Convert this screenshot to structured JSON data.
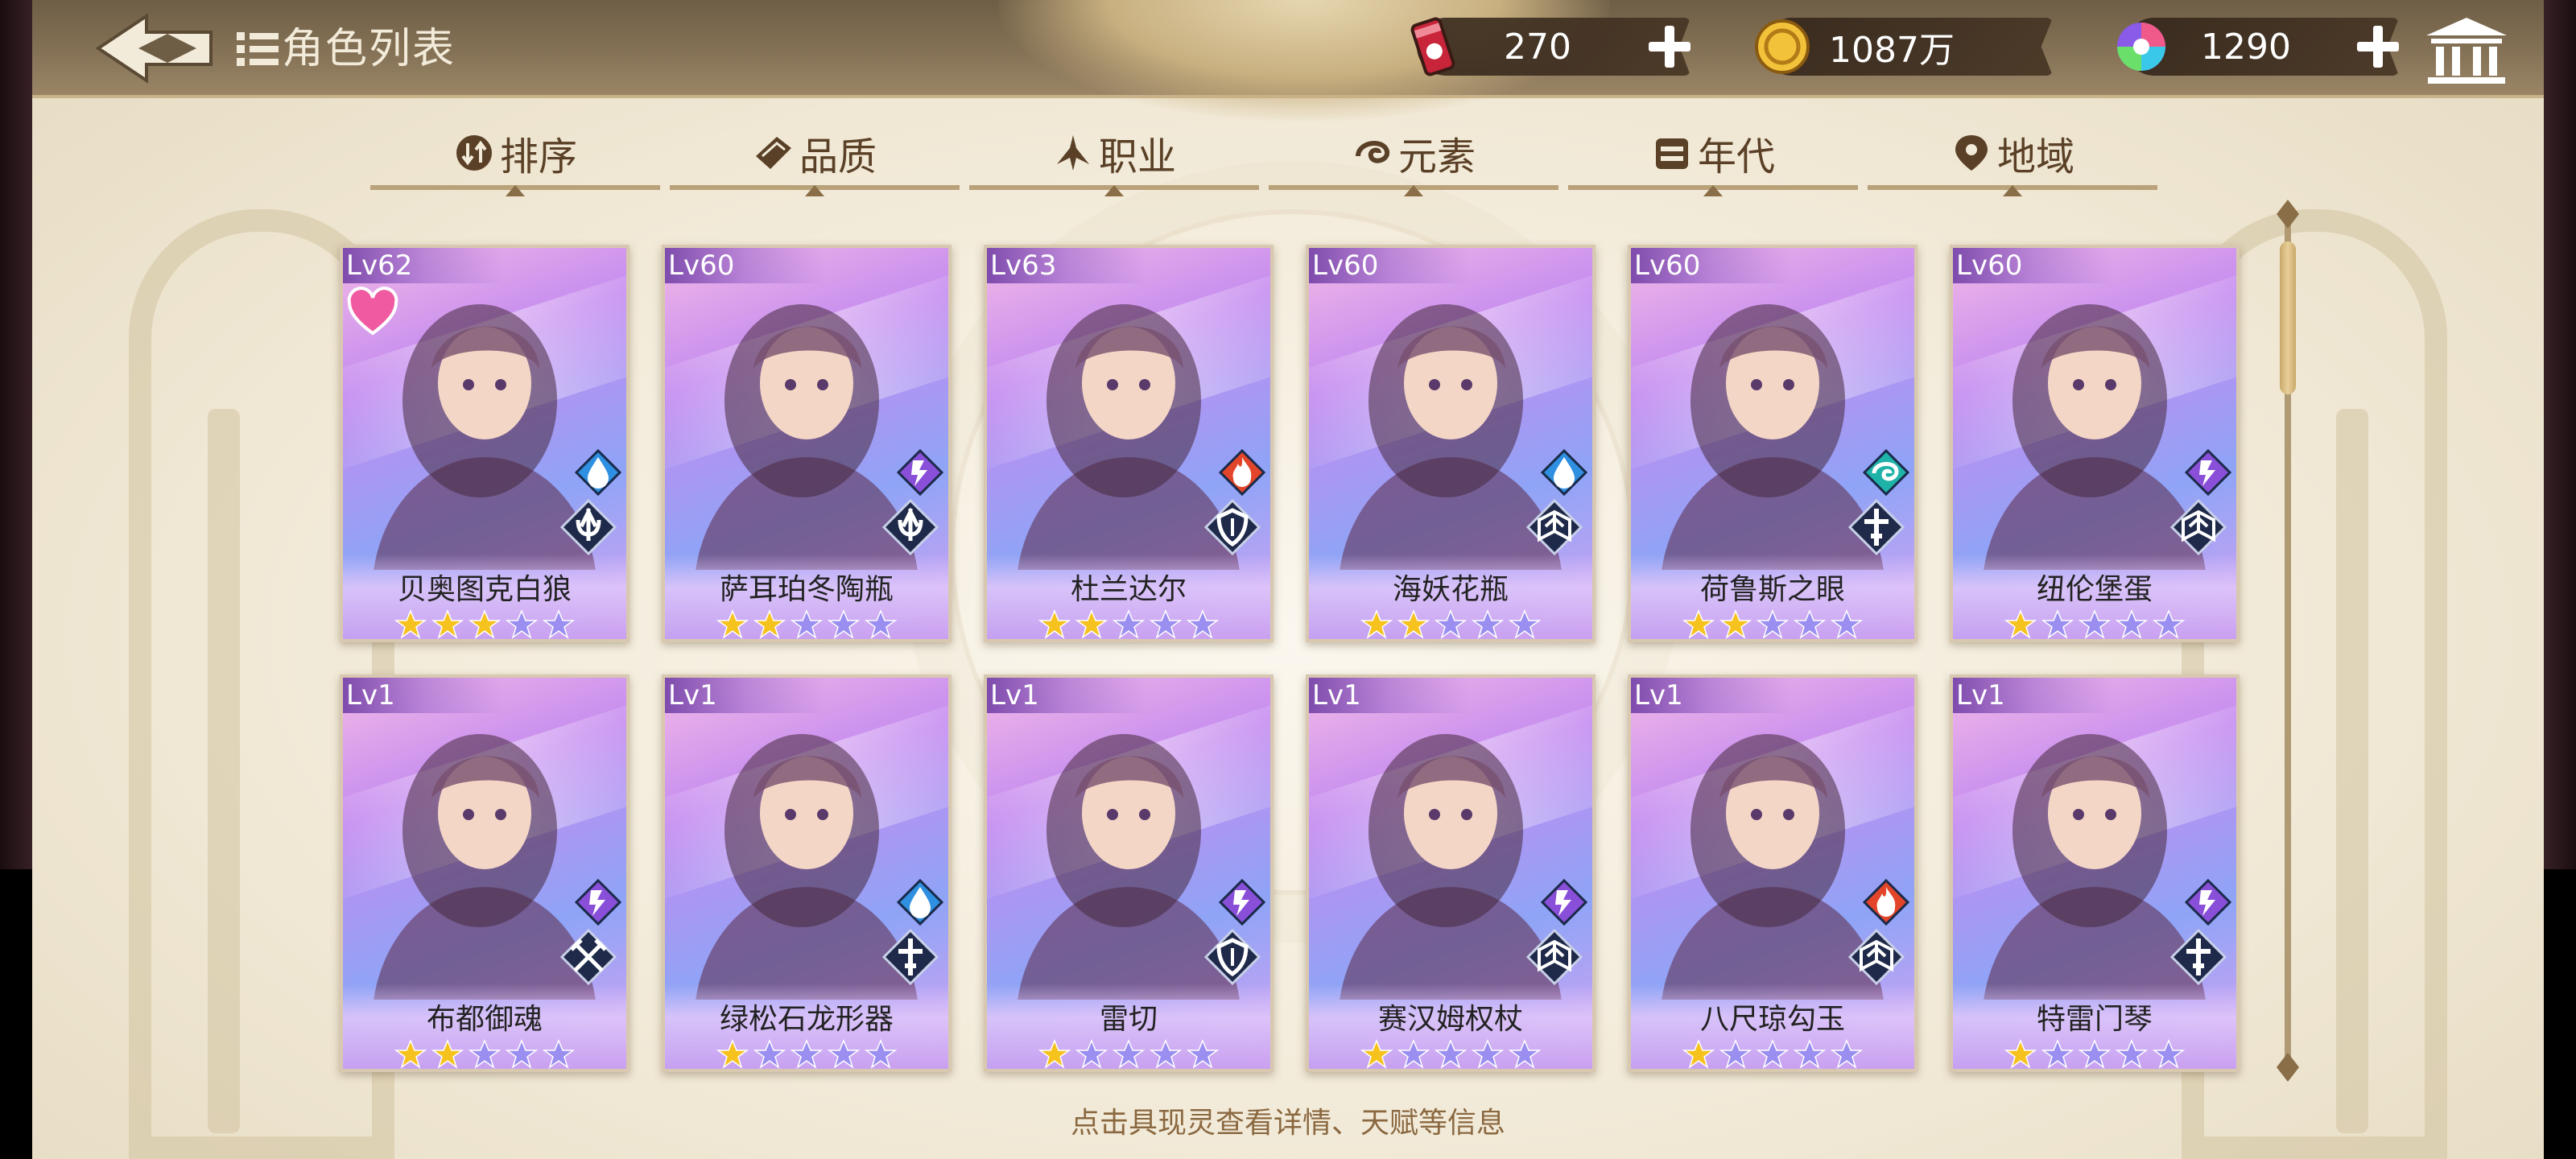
{
  "header": {
    "title": "角色列表",
    "back_icon": "back-arrow-icon",
    "museum_icon": "museum-icon"
  },
  "resources": [
    {
      "icon": "stamina-can-icon",
      "value": "270"
    },
    {
      "icon": "gold-coin-icon",
      "value": "1087万"
    },
    {
      "icon": "rainbow-gem-icon",
      "value": "1290"
    }
  ],
  "tabs": [
    {
      "icon": "sort-icon",
      "label": "排序"
    },
    {
      "icon": "quality-icon",
      "label": "品质"
    },
    {
      "icon": "class-icon",
      "label": "职业"
    },
    {
      "icon": "element-icon",
      "label": "元素"
    },
    {
      "icon": "era-icon",
      "label": "年代"
    },
    {
      "icon": "region-icon",
      "label": "地域"
    }
  ],
  "cards": [
    {
      "level": "Lv62",
      "name": "贝奥图克白狼",
      "stars": 3,
      "element": "water",
      "class": "lance",
      "favorite": true
    },
    {
      "level": "Lv60",
      "name": "萨耳珀冬陶瓶",
      "stars": 2,
      "element": "thunder",
      "class": "lance",
      "favorite": false
    },
    {
      "level": "Lv63",
      "name": "杜兰达尔",
      "stars": 2,
      "element": "fire",
      "class": "shield",
      "favorite": false
    },
    {
      "level": "Lv60",
      "name": "海妖花瓶",
      "stars": 2,
      "element": "water",
      "class": "book",
      "favorite": false
    },
    {
      "level": "Lv60",
      "name": "荷鲁斯之眼",
      "stars": 2,
      "element": "wind",
      "class": "cross",
      "favorite": false
    },
    {
      "level": "Lv60",
      "name": "纽伦堡蛋",
      "stars": 1,
      "element": "thunder",
      "class": "book",
      "favorite": false
    },
    {
      "level": "Lv1",
      "name": "布都御魂",
      "stars": 2,
      "element": "thunder",
      "class": "swords",
      "favorite": false
    },
    {
      "level": "Lv1",
      "name": "绿松石龙形器",
      "stars": 1,
      "element": "water",
      "class": "cross",
      "favorite": false
    },
    {
      "level": "Lv1",
      "name": "雷切",
      "stars": 1,
      "element": "thunder",
      "class": "shield",
      "favorite": false
    },
    {
      "level": "Lv1",
      "name": "赛汉姆权杖",
      "stars": 1,
      "element": "thunder",
      "class": "book",
      "favorite": false
    },
    {
      "level": "Lv1",
      "name": "八尺琼勾玉",
      "stars": 1,
      "element": "fire",
      "class": "book",
      "favorite": false
    },
    {
      "level": "Lv1",
      "name": "特雷门琴",
      "stars": 1,
      "element": "thunder",
      "class": "cross",
      "favorite": false
    }
  ],
  "max_stars": 5,
  "hint": "点击具现灵查看详情、天赋等信息",
  "colors": {
    "water": "#2f8fe0",
    "thunder": "#8a4fd8",
    "fire": "#e2452a",
    "wind": "#1fb2a8",
    "star_on": "#f6c21e",
    "star_off": "#9a8ef0"
  }
}
